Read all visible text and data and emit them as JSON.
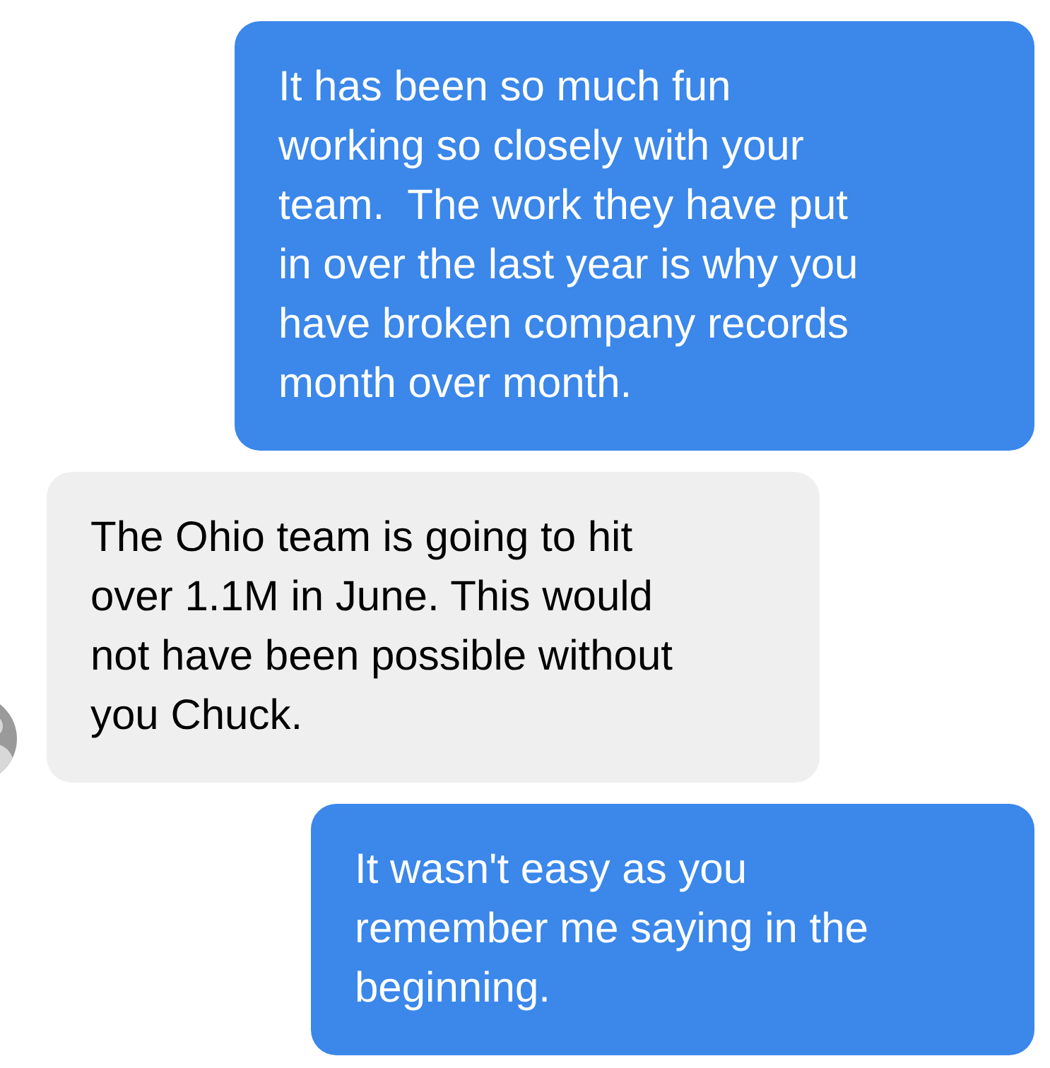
{
  "messages": [
    {
      "kind": "outgoing",
      "lines": [
        "It has been so much fun",
        "working so closely with your",
        "team.  The work they have put",
        "in over the last year is why you",
        "have broken company records",
        "month over month."
      ]
    },
    {
      "kind": "incoming",
      "avatar": true,
      "lines": [
        "The Ohio team is going to hit",
        "over 1.1M in June. This would",
        "not have been possible without",
        "you Chuck."
      ]
    },
    {
      "kind": "outgoing",
      "lines": [
        "It wasn't easy as you",
        "remember me saying in the",
        "beginning."
      ]
    }
  ]
}
